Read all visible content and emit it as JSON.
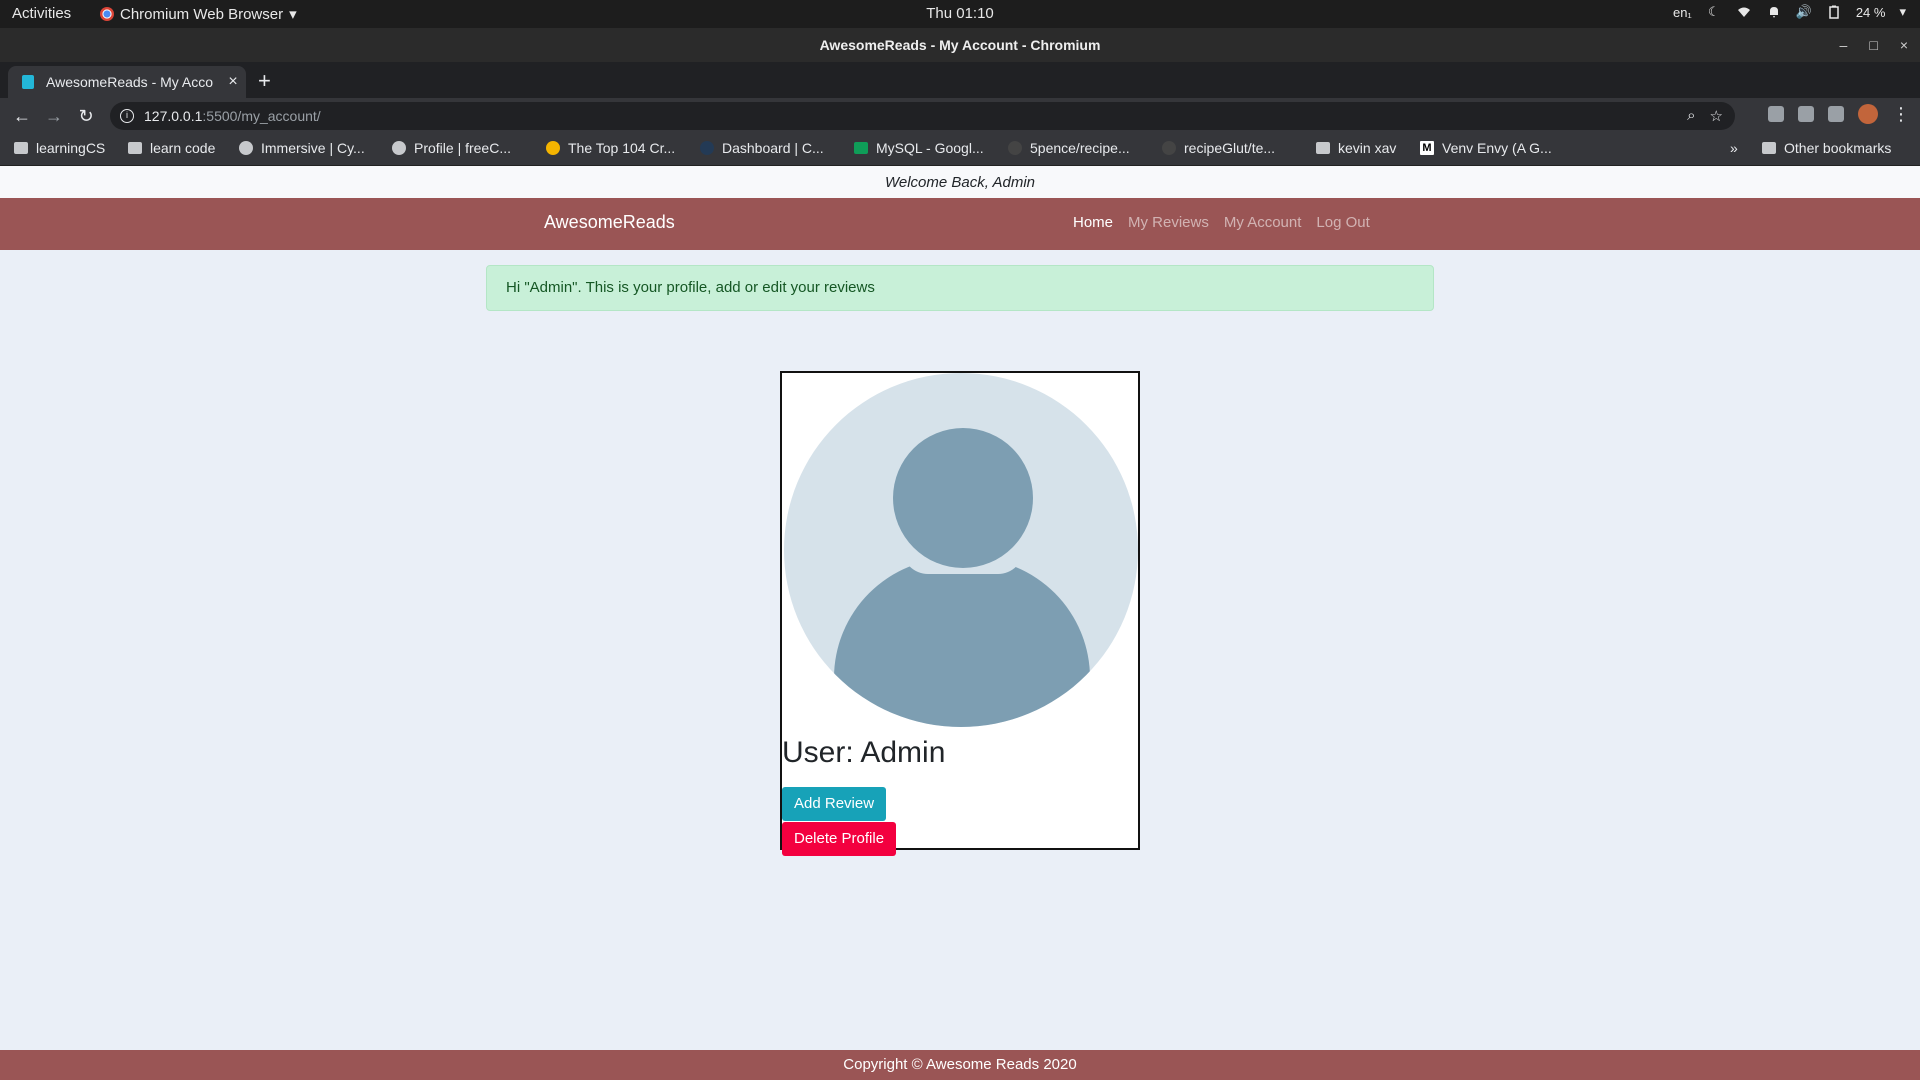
{
  "os_bar": {
    "activities": "Activities",
    "app_menu": "Chromium Web Browser",
    "clock": "Thu 01:10",
    "language": "en₁",
    "battery": "24 %"
  },
  "window": {
    "title": "AwesomeReads - My Account - Chromium"
  },
  "tabs": [
    {
      "title": "AwesomeReads - My Acco"
    }
  ],
  "address_bar": {
    "host": "127.0.0.1",
    "path": ":5500/my_account/"
  },
  "bookmarks": [
    {
      "label": "learningCS",
      "icon": "folder-icon"
    },
    {
      "label": "learn code",
      "icon": "folder-icon"
    },
    {
      "label": "Immersive | Cy...",
      "icon": "site-icon"
    },
    {
      "label": "Profile | freeC...",
      "icon": "site-icon"
    },
    {
      "label": "The Top 104 Cr...",
      "icon": "site-icon"
    },
    {
      "label": "Dashboard | C...",
      "icon": "site-icon"
    },
    {
      "label": "MySQL - Googl...",
      "icon": "drive-icon"
    },
    {
      "label": "5pence/recipe...",
      "icon": "github-icon"
    },
    {
      "label": "recipeGlut/te...",
      "icon": "github-icon"
    },
    {
      "label": "kevin xav",
      "icon": "folder-icon"
    },
    {
      "label": "Venv Envy (A G...",
      "icon": "medium-icon"
    }
  ],
  "bookmarks_more": "»",
  "other_bookmarks": "Other bookmarks",
  "page": {
    "welcome": "Welcome Back, Admin",
    "brand": "AwesomeReads",
    "nav": {
      "home": "Home",
      "my_reviews": "My Reviews",
      "my_account": "My Account",
      "log_out": "Log Out"
    },
    "alert": "Hi \"Admin\". This is your profile, add or edit your reviews",
    "profile": {
      "user_label": "User: Admin",
      "add_review": "Add Review",
      "delete_profile": "Delete Profile"
    },
    "footer": "Copyright © Awesome Reads 2020"
  },
  "colors": {
    "navbar": "#9a5555",
    "alert_bg": "#c8f0d8",
    "add_btn": "#17a2b8",
    "delete_btn": "#f3003f"
  }
}
